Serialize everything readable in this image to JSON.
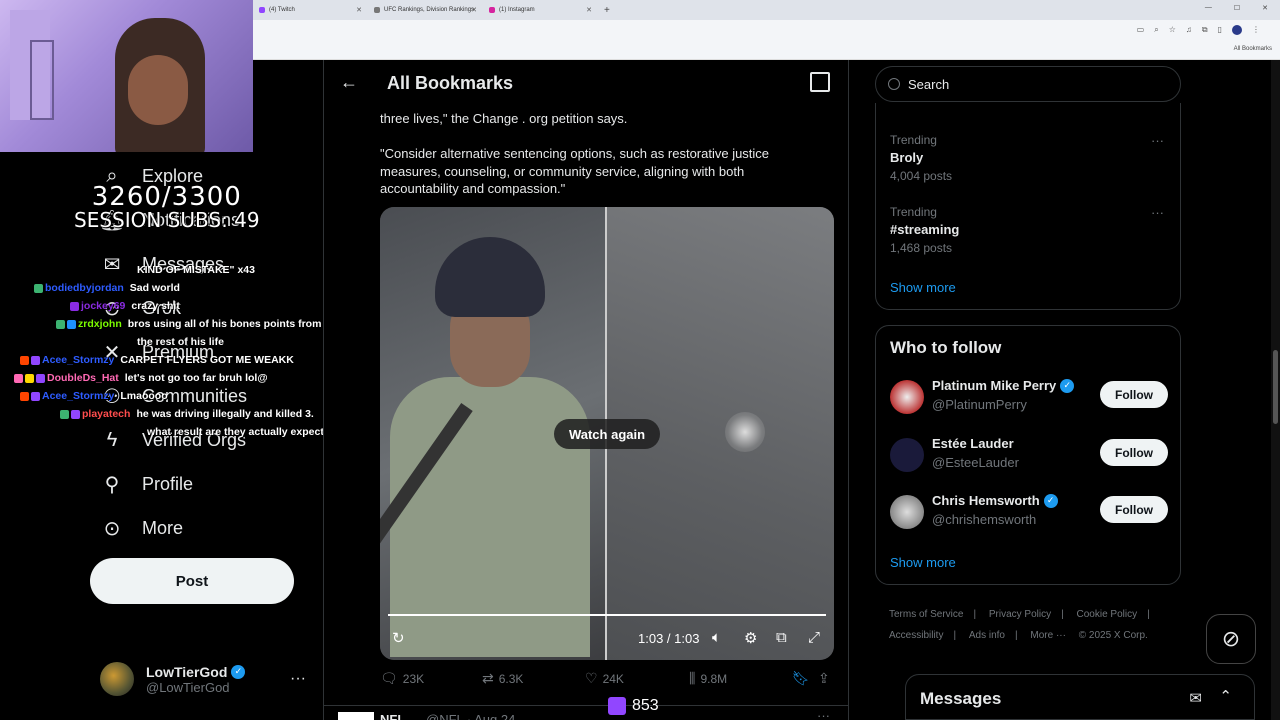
{
  "browser": {
    "tabs": [
      {
        "label": "(4) Twitch"
      },
      {
        "label": "UFC Rankings, Division Rankings"
      },
      {
        "label": "(1) Instagram"
      }
    ],
    "new_tab": "+",
    "bookmarks_folder": "All Bookmarks"
  },
  "overlay": {
    "sub_count": "3260/3300",
    "session_subs": "SESSION SUBS: 49",
    "viewer_count": "853",
    "chat": [
      {
        "user": "",
        "message": "KIND OF MISTAKE\" x43",
        "color": "#ffffff"
      },
      {
        "user": "bodiedbyjordan",
        "message": "Sad world",
        "color": "#2e5cff"
      },
      {
        "user": "jockey69",
        "message": "crazy shit",
        "color": "#8a2be2"
      },
      {
        "user": "zrdxjohn",
        "message": "bros using all of his bones points from",
        "color": "#7cfc00"
      },
      {
        "user": "",
        "message": "the rest of his life",
        "color": "#ffffff"
      },
      {
        "user": "Acee_Stormzy",
        "message": "CARPET FLYERS GOT ME WEAKK",
        "color": "#2e5cff"
      },
      {
        "user": "DoubleDs_Hat",
        "message": "let's not go too far bruh lol@",
        "color": "#ff69b4"
      },
      {
        "user": "Acee_Stormzy",
        "message": "Lmaoooo",
        "color": "#2e5cff"
      },
      {
        "user": "playatech",
        "message": "he was driving illegally and killed 3.",
        "color": "#ff4d4d"
      },
      {
        "user": "",
        "message": "what result are they actually expecting",
        "color": "#ffffff"
      }
    ]
  },
  "sidebar": {
    "items": [
      {
        "label": "Explore",
        "icon": "search-icon"
      },
      {
        "label": "Notifications",
        "icon": "bell-icon"
      },
      {
        "label": "Messages",
        "icon": "mail-icon"
      },
      {
        "label": "Grok",
        "icon": "grok-icon"
      },
      {
        "label": "Premium",
        "icon": "x-logo-icon"
      },
      {
        "label": "Communities",
        "icon": "people-icon"
      },
      {
        "label": "Verified Orgs",
        "icon": "lightning-icon"
      },
      {
        "label": "Profile",
        "icon": "person-icon"
      },
      {
        "label": "More",
        "icon": "more-circle-icon"
      }
    ],
    "post_label": "Post",
    "account": {
      "name": "LowTierGod",
      "handle": "@LowTierGod"
    }
  },
  "main": {
    "title": "All Bookmarks",
    "tweet": {
      "text_top": "three lives,\" the Change . org petition says.",
      "text_quote": "\"Consider alternative sentencing options, such as restorative justice measures, counseling, or community service, aligning with both accountability and compassion.\"",
      "video": {
        "watch_again": "Watch again",
        "time": "1:03 / 1:03",
        "progress": 1.0
      },
      "actions": {
        "replies": "23K",
        "reposts": "6.3K",
        "likes": "24K",
        "views": "9.8M"
      }
    },
    "next_tweet": {
      "name": "NFL",
      "handle": "@NFL · Aug 24"
    }
  },
  "right": {
    "search_placeholder": "Search",
    "trends": [
      {
        "context": "Trending",
        "name": "Broly",
        "count": "4,004 posts"
      },
      {
        "context": "Trending",
        "name": "#streaming",
        "count": "1,468 posts"
      }
    ],
    "show_more": "Show more",
    "who_to_follow": {
      "title": "Who to follow",
      "accounts": [
        {
          "name": "Platinum Mike Perry",
          "handle": "@PlatinumPerry",
          "verified": true
        },
        {
          "name": "Estée Lauder",
          "handle": "@EsteeLauder",
          "verified": false
        },
        {
          "name": "Chris Hemsworth",
          "handle": "@chrishemsworth",
          "verified": true
        }
      ],
      "follow_label": "Follow",
      "show_more": "Show more"
    },
    "footer": {
      "terms": "Terms of Service",
      "privacy": "Privacy Policy",
      "cookie": "Cookie Policy",
      "accessibility": "Accessibility",
      "ads": "Ads info",
      "more": "More ···",
      "copyright": "© 2025 X Corp."
    },
    "messages_drawer": "Messages"
  }
}
